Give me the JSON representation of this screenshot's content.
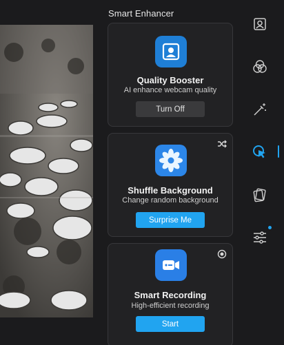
{
  "panel": {
    "title": "Smart Enhancer"
  },
  "cards": [
    {
      "title": "Quality Booster",
      "description": "AI enhance webcam quality",
      "button_label": "Turn Off",
      "button_state": "active-off",
      "icon": "portrait-icon"
    },
    {
      "title": "Shuffle Background",
      "description": "Change random background",
      "button_label": "Surprise Me",
      "icon": "flower-icon",
      "corner_icon": "shuffle-icon"
    },
    {
      "title": "Smart Recording",
      "description": "High-efficient recording",
      "button_label": "Start",
      "icon": "video-camera-icon",
      "corner_icon": "record-icon"
    }
  ],
  "rail": {
    "items": [
      "portrait-icon",
      "color-circles-icon",
      "magic-wand-icon",
      "smart-cursor-icon",
      "stickers-icon",
      "adjust-sliders-icon"
    ],
    "active": "smart-cursor-icon"
  },
  "colors": {
    "accent": "#21a4f0",
    "background": "#1b1b1d",
    "card": "#222224"
  }
}
